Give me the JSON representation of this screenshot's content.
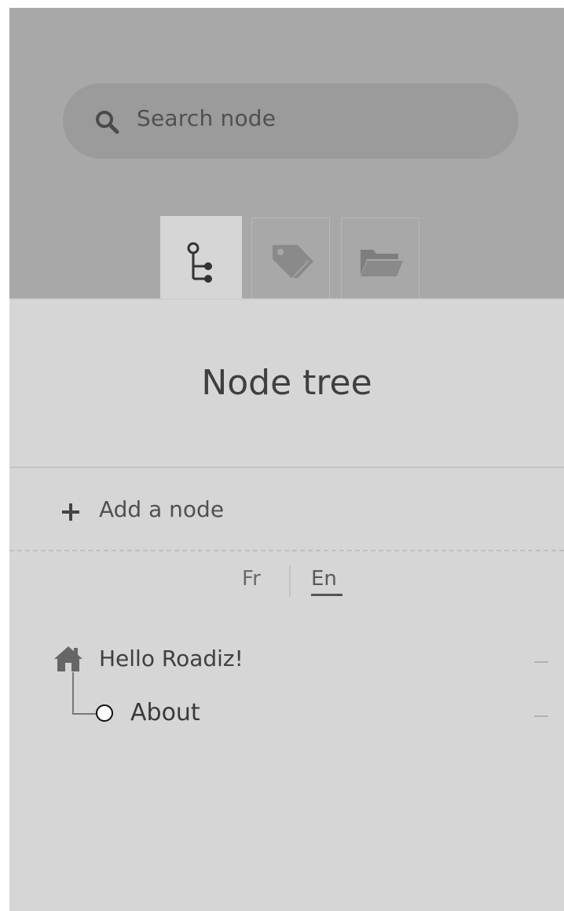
{
  "search": {
    "placeholder": "Search node"
  },
  "tabs": [
    {
      "name": "node-tree",
      "icon": "tree-icon",
      "active": true
    },
    {
      "name": "tags",
      "icon": "tags-icon",
      "active": false
    },
    {
      "name": "folders",
      "icon": "folder-icon",
      "active": false
    }
  ],
  "panel": {
    "title": "Node tree",
    "add_label": "Add a node"
  },
  "languages": {
    "items": [
      "Fr",
      "En"
    ],
    "selected": "En"
  },
  "tree": {
    "nodes": [
      {
        "label": "Hello Roadiz!",
        "icon": "home-icon",
        "level": 0
      },
      {
        "label": "About",
        "icon": "circle-icon",
        "level": 1
      }
    ]
  },
  "colors": {
    "header_bg": "#a8a8a8",
    "panel_bg": "#d6d6d6",
    "search_bg": "#9b9b9b"
  }
}
